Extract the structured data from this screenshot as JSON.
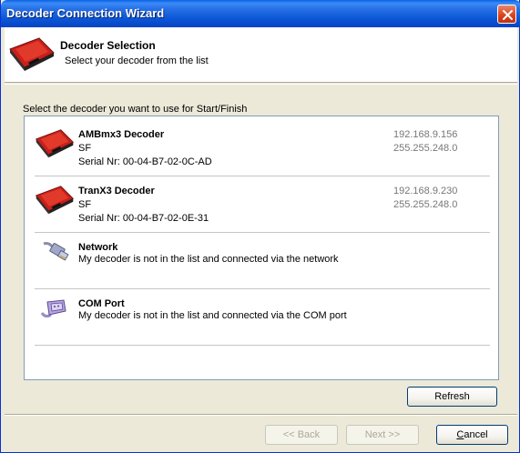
{
  "window": {
    "title": "Decoder Connection Wizard"
  },
  "header": {
    "title": "Decoder Selection",
    "subtitle": "Select your decoder from the list"
  },
  "main": {
    "prompt": "Select the decoder you want to use for Start/Finish",
    "items": [
      {
        "name": "AMBmx3 Decoder",
        "line2": "SF",
        "line3": "Serial Nr: 00-04-B7-02-0C-AD",
        "ip": "192.168.9.156",
        "mask": "255.255.248.0",
        "icon": "decoder-icon"
      },
      {
        "name": "TranX3 Decoder",
        "line2": "SF",
        "line3": "Serial Nr: 00-04-B7-02-0E-31",
        "ip": "192.168.9.230",
        "mask": "255.255.248.0",
        "icon": "decoder-icon"
      },
      {
        "name": "Network",
        "desc": "My decoder is not in the list and connected via the network",
        "icon": "network-cable-icon"
      },
      {
        "name": "COM Port",
        "desc": "My decoder is not in the list and connected via the COM port",
        "icon": "serial-port-icon"
      }
    ],
    "refresh_label": "Refresh"
  },
  "footer": {
    "back_label": "<< Back",
    "next_label": "Next >>",
    "cancel_label_first": "C",
    "cancel_label_rest": "ancel"
  },
  "colors": {
    "titlebar": "#0a55d6",
    "accent_red": "#c8201c",
    "face": "#ece9d8"
  }
}
